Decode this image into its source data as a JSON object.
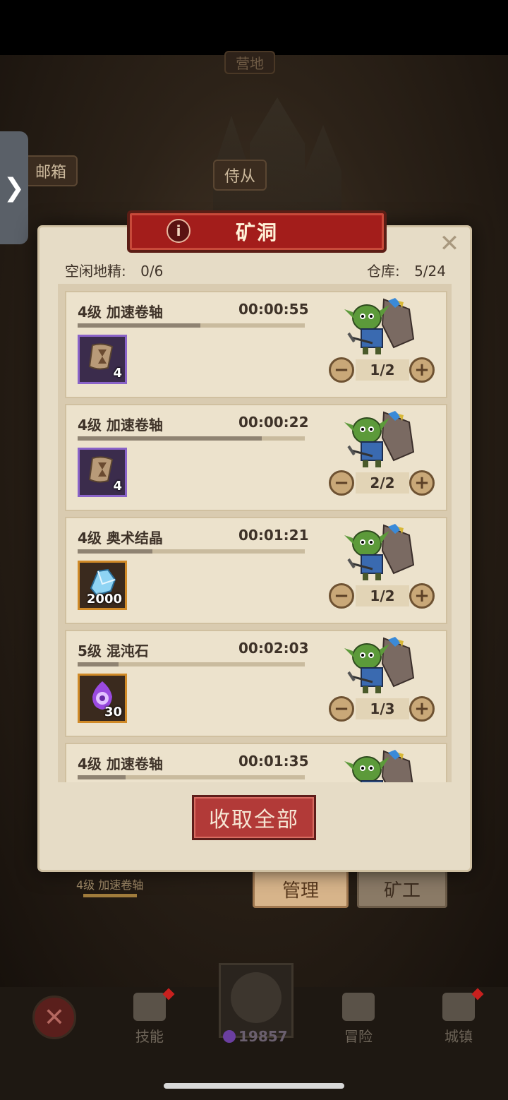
{
  "background": {
    "banner_mailbox": "邮箱",
    "banner_attendant": "侍从",
    "banner_top": "营地",
    "side_tab_icon": "chevron-right-icon",
    "progress_label": "4级 加速卷轴",
    "manage_label": "管理",
    "miner_label": "矿工"
  },
  "dialog": {
    "title": "矿洞",
    "idle_goblins_label": "空闲地精:",
    "idle_goblins_value": "0/6",
    "storage_label": "仓库:",
    "storage_value": "5/24",
    "collect_all_label": "收取全部",
    "mines": [
      {
        "title": "4级 加速卷轴",
        "timer": "00:00:55",
        "progress": 0.54,
        "item_icon": "scroll-hourglass-icon",
        "item_count": "4",
        "workers": "1/2",
        "rarity_color": "#8a63c8"
      },
      {
        "title": "4级 加速卷轴",
        "timer": "00:00:22",
        "progress": 0.81,
        "item_icon": "scroll-hourglass-icon",
        "item_count": "4",
        "workers": "2/2",
        "rarity_color": "#8a63c8"
      },
      {
        "title": "4级 奥术结晶",
        "timer": "00:01:21",
        "progress": 0.33,
        "item_icon": "crystal-icon",
        "item_count": "2000",
        "workers": "1/2",
        "rarity_color": "#d08a28"
      },
      {
        "title": "5级 混沌石",
        "timer": "00:02:03",
        "progress": 0.18,
        "item_icon": "chaos-stone-icon",
        "item_count": "30",
        "workers": "1/3",
        "rarity_color": "#d08a28"
      },
      {
        "title": "4级 加速卷轴",
        "timer": "00:01:35",
        "progress": 0.21,
        "item_icon": "scroll-hourglass-icon",
        "item_count": "",
        "workers": "",
        "rarity_color": "#8a63c8"
      }
    ]
  },
  "bottom_nav": {
    "skills_label": "技能",
    "adventure_label": "冒险",
    "town_label": "城镇",
    "currency_value": "19857"
  }
}
